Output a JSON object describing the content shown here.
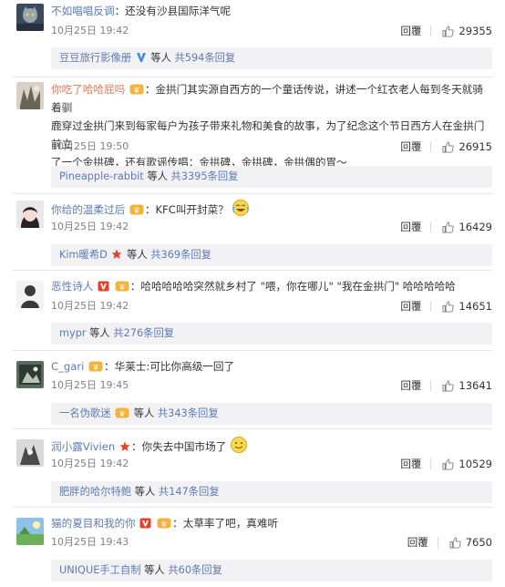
{
  "comments": [
    {
      "user": "不如唱唱反调",
      "text": "：还没有沙县国际洋气呢",
      "time": "10月25日 19:42",
      "reply": "回覆",
      "likes": "29355",
      "sub_name": "豆豆旅行影像册",
      "sub_mid": " 等人 ",
      "sub_link": "共594条回复"
    },
    {
      "user": "你吃了哈哈屁吗",
      "text_lines": [
        "：金拱门其实源自西方的一个童话传说，讲述一个红衣老人每到冬天就骑着驯",
        "鹿穿过金拱门来到每家每户为孩子带来礼物和美食的故事，为了纪念这个节日西方人在金拱门前立",
        "了一个金拱碑，还有歌谣传唱：金拱碑，金拱碑，金拱偶的胃～"
      ],
      "time": "10月25日 19:50",
      "reply": "回覆",
      "likes": "26915",
      "sub_name": "Pineapple-rabbit",
      "sub_mid": " 等人 ",
      "sub_link": "共3395条回复"
    },
    {
      "user": "你给的温柔过后",
      "text": "：KFC叫开封菜？",
      "time": "10月25日 19:42",
      "reply": "回覆",
      "likes": "16429",
      "sub_name": "Kim暖希D",
      "sub_mid": " 等人 ",
      "sub_link": "共369条回复"
    },
    {
      "user": "恶性诗人",
      "text": "：哈哈哈哈哈突然就乡村了 \"喂，你在哪儿\" \"我在金拱门\" 哈哈哈哈哈",
      "time": "10月25日 19:42",
      "reply": "回覆",
      "likes": "14651",
      "sub_name": "mypr",
      "sub_mid": " 等人 ",
      "sub_link": "共276条回复"
    },
    {
      "user": "C_gari",
      "text": "：华莱士:可比你高级一回了",
      "time": "10月25日 19:45",
      "reply": "回覆",
      "likes": "13641",
      "sub_name": "一名伪歌迷",
      "sub_mid": " 等人 ",
      "sub_link": "共343条回复"
    },
    {
      "user": "润小露Vivien",
      "text": "：你失去中国市场了",
      "time": "10月25日 19:42",
      "reply": "回覆",
      "likes": "10529",
      "sub_name": "肥胖的哈尔特鲍",
      "sub_mid": " 等人 ",
      "sub_link": "共147条回复"
    },
    {
      "user": "猫的夏目和我的你",
      "text": "：太草率了吧，真难听",
      "time": "10月25日 19:43",
      "reply": "回覆",
      "likes": "7650",
      "sub_name": "UNIQUE手工自制",
      "sub_mid": " 等人 ",
      "sub_link": "共60条回复"
    }
  ],
  "colors": {
    "username": "#eb7350",
    "link": "#5d7bb5",
    "reply_bg": "#f2f2f5",
    "divider": "#e6e6e6"
  }
}
